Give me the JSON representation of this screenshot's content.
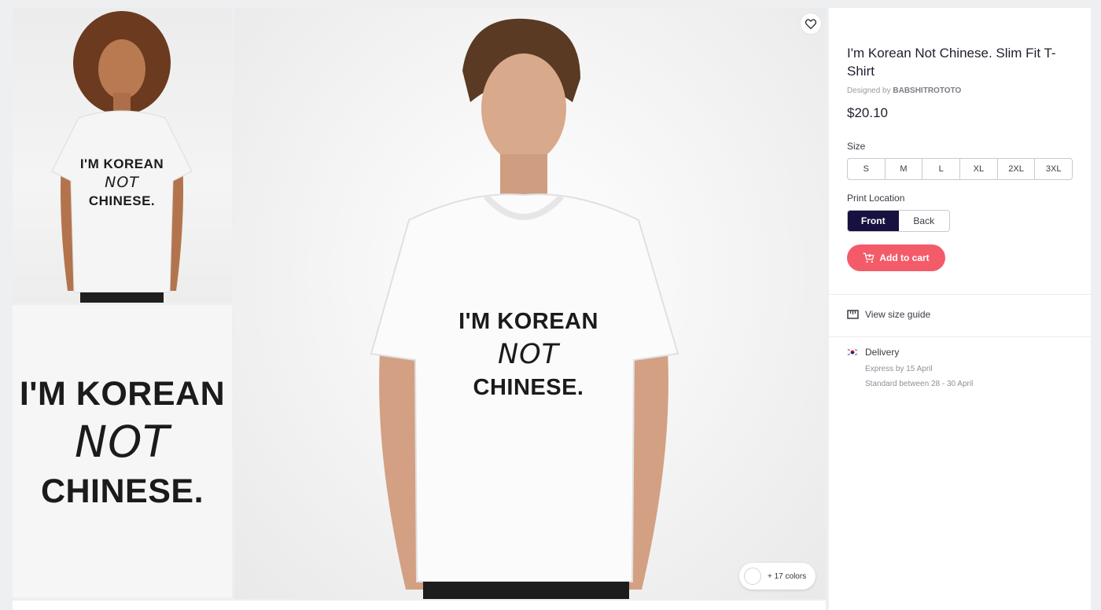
{
  "product": {
    "title": "I'm Korean Not Chinese. Slim Fit T-Shirt",
    "designer_prefix": "Designed by",
    "designer_name": "BABSHITROTOTO",
    "price": "$20.10"
  },
  "gallery": {
    "print_line_1": "I'M KOREAN",
    "print_line_2": "NOT",
    "print_line_3": "CHINESE.",
    "colors_label": "+ 17 colors"
  },
  "options": {
    "size_label": "Size",
    "sizes": [
      "S",
      "M",
      "L",
      "XL",
      "2XL",
      "3XL"
    ],
    "print_location_label": "Print Location",
    "print_locations": [
      "Front",
      "Back"
    ],
    "selected_print_location": "Front"
  },
  "actions": {
    "add_to_cart": "Add to cart",
    "size_guide": "View size guide"
  },
  "delivery": {
    "title": "Delivery",
    "express": "Express by 15 April",
    "standard": "Standard between 28 - 30 April"
  },
  "colors": {
    "accent_cart": "#f45b69",
    "selected_option": "#16113f"
  },
  "icons": {
    "favorite": "heart-icon",
    "cart": "cart-icon",
    "size_guide": "ruler-icon",
    "delivery": "flag-icon"
  }
}
